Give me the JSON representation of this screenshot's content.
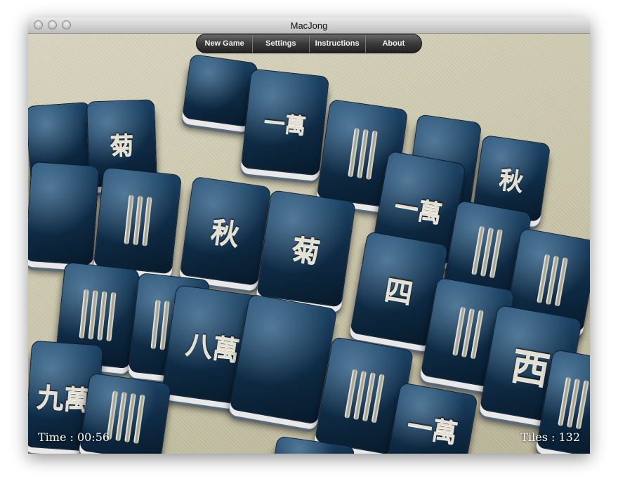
{
  "window": {
    "title": "MacJong"
  },
  "toolbar": {
    "new_game": "New Game",
    "settings": "Settings",
    "instructions": "Instructions",
    "about": "About"
  },
  "hud": {
    "time": "Time : 00:56",
    "tiles": "Tiles : 132"
  },
  "tiles": [
    "一萬",
    "秋",
    "菊",
    "八萬",
    "九萬",
    "西",
    "四"
  ]
}
